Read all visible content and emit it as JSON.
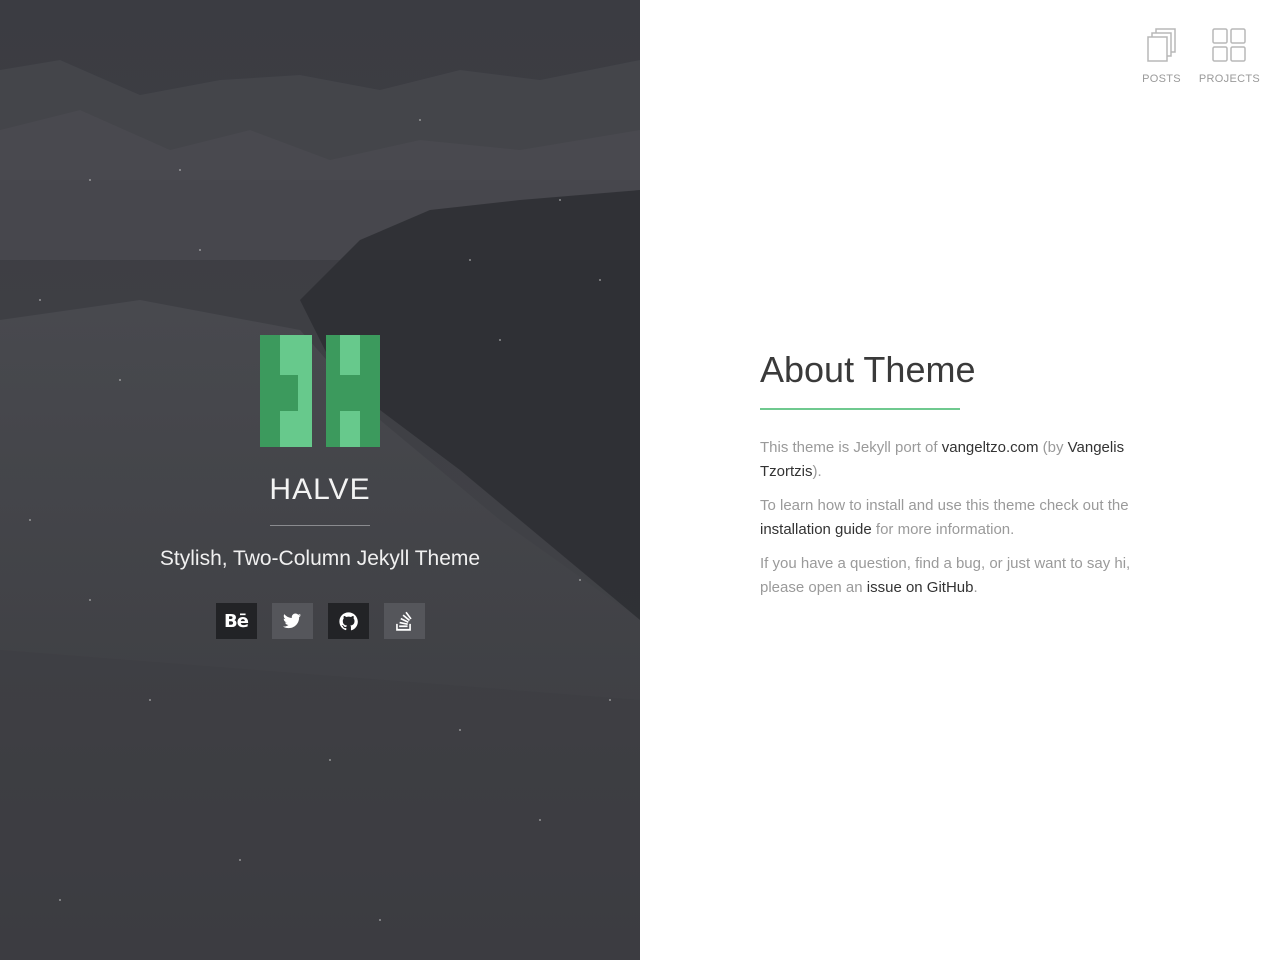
{
  "brand": {
    "title": "HALVE",
    "tagline": "Stylish, Two-Column Jekyll Theme",
    "accent_color": "#6fc98f",
    "logo_dark_color": "#3c9a5d",
    "logo_light_color": "#67c98c"
  },
  "social": [
    {
      "name": "behance",
      "label": "Bē",
      "icon": "behance-icon"
    },
    {
      "name": "twitter",
      "label": "",
      "icon": "twitter-icon"
    },
    {
      "name": "github",
      "label": "",
      "icon": "github-icon"
    },
    {
      "name": "stackoverflow",
      "label": "",
      "icon": "stackoverflow-icon"
    }
  ],
  "nav": {
    "posts_label": "POSTS",
    "projects_label": "PROJECTS"
  },
  "about": {
    "heading": "About Theme",
    "p1_before": "This theme is Jekyll port of ",
    "p1_link1": "vangeltzo.com",
    "p1_mid": " (by ",
    "p1_link2": "Vangelis Tzortzis",
    "p1_after": ").",
    "p2_before": "To learn how to install and use this theme check out the ",
    "p2_link": "installation guide",
    "p2_after": " for more information.",
    "p3_before": "If you have a question, find a bug, or just want to say hi, please open an ",
    "p3_link": "issue on GitHub",
    "p3_after": "."
  }
}
